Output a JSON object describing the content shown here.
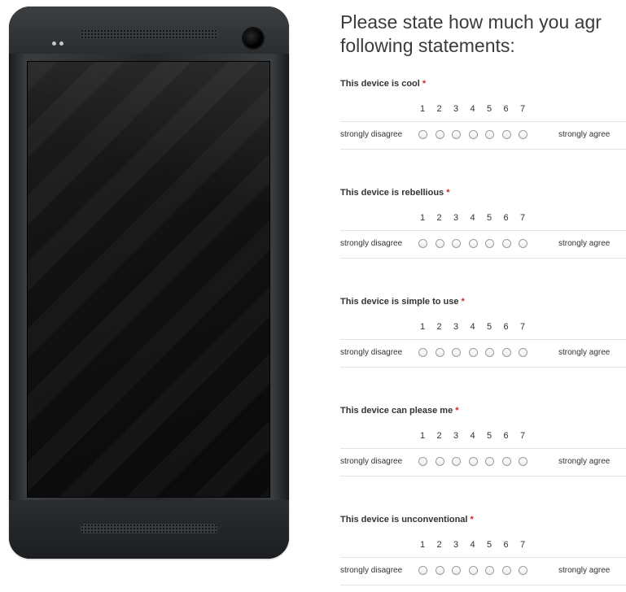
{
  "survey": {
    "heading_line1": "Please state how much you agr",
    "heading_line2": "following statements:",
    "required_mark": "*",
    "scale_numbers": [
      "1",
      "2",
      "3",
      "4",
      "5",
      "6",
      "7"
    ],
    "left_label": "strongly disagree",
    "right_label": "strongly agree",
    "questions": [
      {
        "text": "This device is cool"
      },
      {
        "text": "This device is rebellious"
      },
      {
        "text": "This device is simple to use"
      },
      {
        "text": "This device can please me"
      },
      {
        "text": "This device is unconventional"
      }
    ]
  },
  "colors": {
    "required": "#cc2b2b",
    "phone_body": "#2a2d30",
    "screen": "#111111"
  }
}
